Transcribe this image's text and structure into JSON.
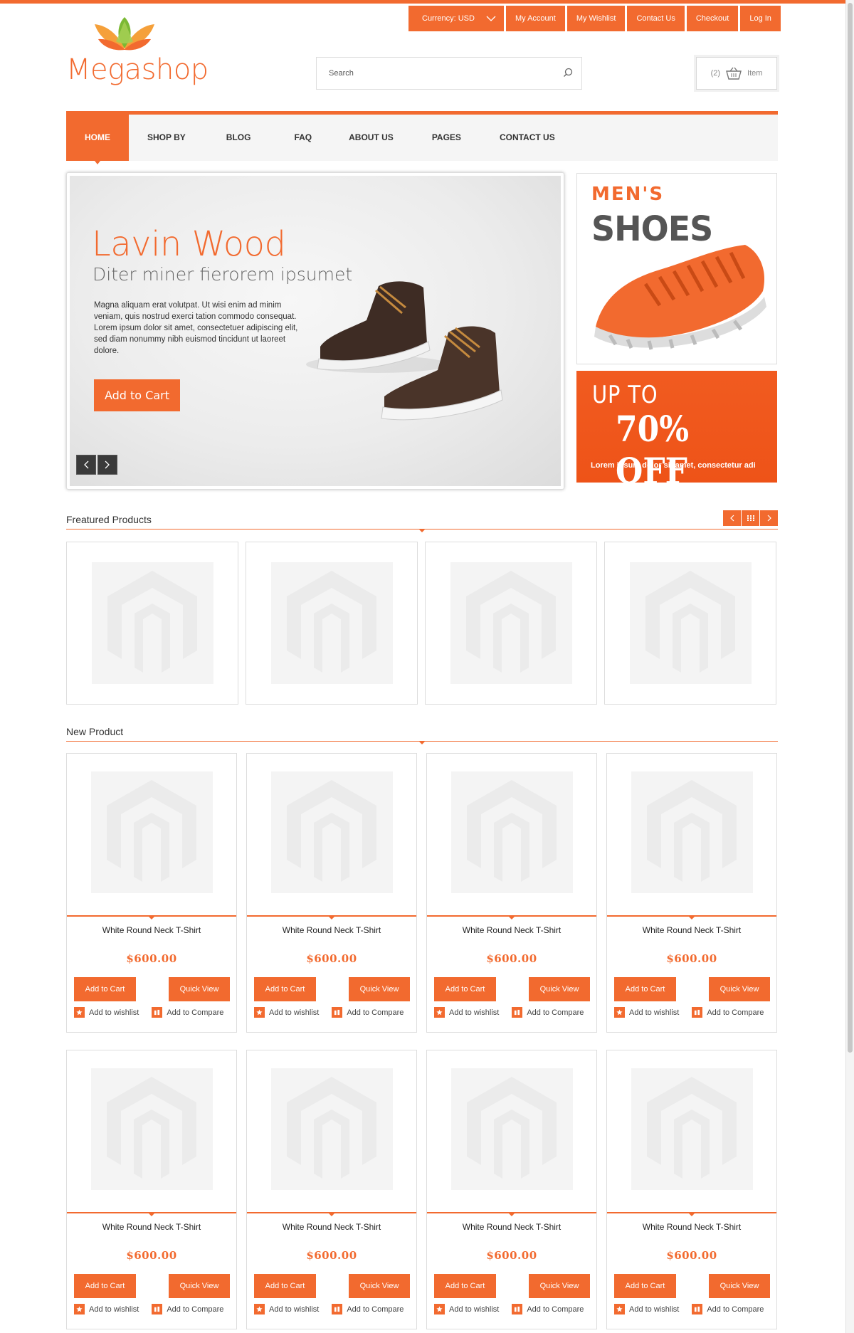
{
  "brand": {
    "logo_text": "Megashop",
    "accent": "#f26a2f"
  },
  "toplinks": {
    "currency": "Currency: USD",
    "items": [
      "My Account",
      "My Wishlist",
      "Contact Us",
      "Checkout",
      "Log In"
    ]
  },
  "search": {
    "placeholder": "Search",
    "icon": "search-icon"
  },
  "cart": {
    "count": "(2)",
    "label": "Item",
    "icon": "basket-icon"
  },
  "nav": {
    "items": [
      "HOME",
      "SHOP BY",
      "BLOG",
      "FAQ",
      "ABOUT US",
      "PAGES",
      "CONTACT US"
    ],
    "active": "HOME"
  },
  "slider": {
    "title": "Lavin Wood",
    "subtitle": "Diter miner fierorem ipsumet",
    "body": "Magna aliquam erat volutpat. Ut wisi enim ad minim veniam, quis nostrud exerci tation commodo consequat. Lorem ipsum dolor sit amet, consectetuer adipiscing elit, sed diam nonummy nibh euismod tincidunt ut laoreet dolore.",
    "button": "Add to Cart"
  },
  "banners": {
    "mens": "MEN'S",
    "shoes": "SHOES",
    "upto": "UP TO",
    "off": "70% OFF",
    "small": "Lorem ipsum dolor sit amet, consectetur adi"
  },
  "featured": {
    "title": "Freatured Products",
    "count": 4
  },
  "new_products": {
    "title": "New Product",
    "items": [
      {
        "name": "White Round Neck T-Shirt",
        "price": "$600.00"
      },
      {
        "name": "White Round Neck T-Shirt",
        "price": "$600.00"
      },
      {
        "name": "White Round Neck T-Shirt",
        "price": "$600.00"
      },
      {
        "name": "White Round Neck T-Shirt",
        "price": "$600.00"
      },
      {
        "name": "White Round Neck T-Shirt",
        "price": "$600.00"
      },
      {
        "name": "White Round Neck T-Shirt",
        "price": "$600.00"
      },
      {
        "name": "White Round Neck T-Shirt",
        "price": "$600.00"
      },
      {
        "name": "White Round Neck T-Shirt",
        "price": "$600.00"
      }
    ],
    "add_to_cart": "Add to Cart",
    "quick_view": "Quick View",
    "wishlist": "Add to wishlist",
    "compare": "Add to Compare"
  }
}
